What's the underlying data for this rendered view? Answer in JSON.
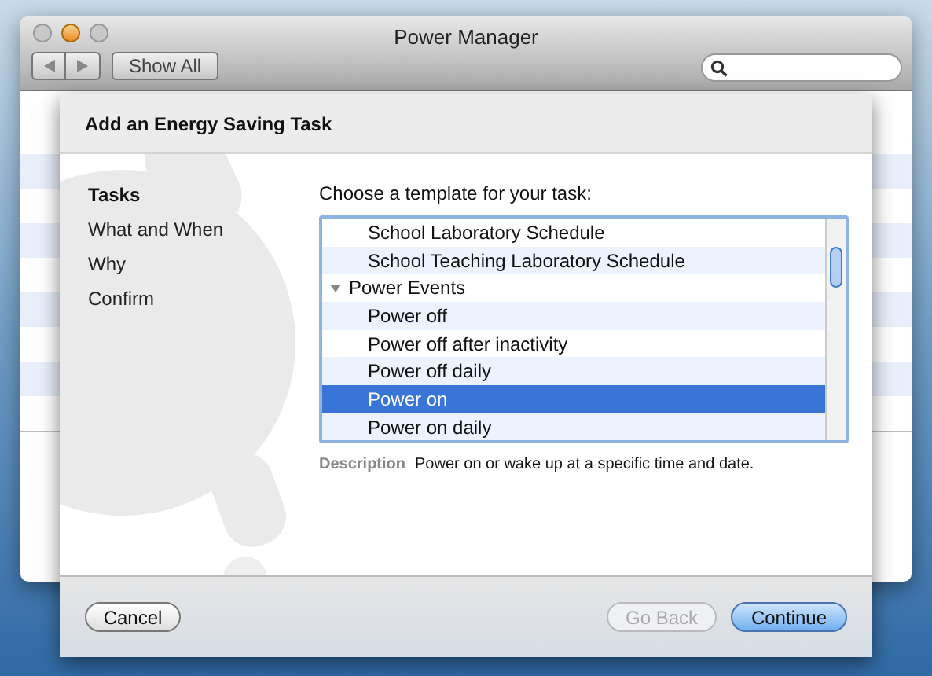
{
  "window": {
    "title": "Power Manager"
  },
  "toolbar": {
    "show_all": "Show All"
  },
  "sheet": {
    "title": "Add an Energy Saving Task",
    "steps": [
      {
        "label": "Tasks",
        "selected": true
      },
      {
        "label": "What and When",
        "selected": false
      },
      {
        "label": "Why",
        "selected": false
      },
      {
        "label": "Confirm",
        "selected": false
      }
    ],
    "prompt": "Choose a template for your task:",
    "templates": [
      {
        "kind": "item",
        "label": "School Laboratory Schedule",
        "selected": false
      },
      {
        "kind": "item",
        "label": "School Teaching Laboratory Schedule",
        "selected": false
      },
      {
        "kind": "group",
        "label": "Power Events",
        "expanded": true,
        "selected": false
      },
      {
        "kind": "item",
        "label": "Power off",
        "selected": false
      },
      {
        "kind": "item",
        "label": "Power off after inactivity",
        "selected": false
      },
      {
        "kind": "item",
        "label": "Power off daily",
        "selected": false
      },
      {
        "kind": "item",
        "label": "Power on",
        "selected": true
      },
      {
        "kind": "item",
        "label": "Power on daily",
        "selected": false
      }
    ],
    "description_label": "Description",
    "description": "Power on or wake up at a specific time and date.",
    "buttons": [
      {
        "kind": "cancel",
        "label": "Cancel",
        "disabled": false,
        "default": false
      },
      {
        "kind": "back",
        "label": "Go Back",
        "disabled": true,
        "default": false
      },
      {
        "kind": "continue",
        "label": "Continue",
        "disabled": false,
        "default": true
      }
    ]
  }
}
